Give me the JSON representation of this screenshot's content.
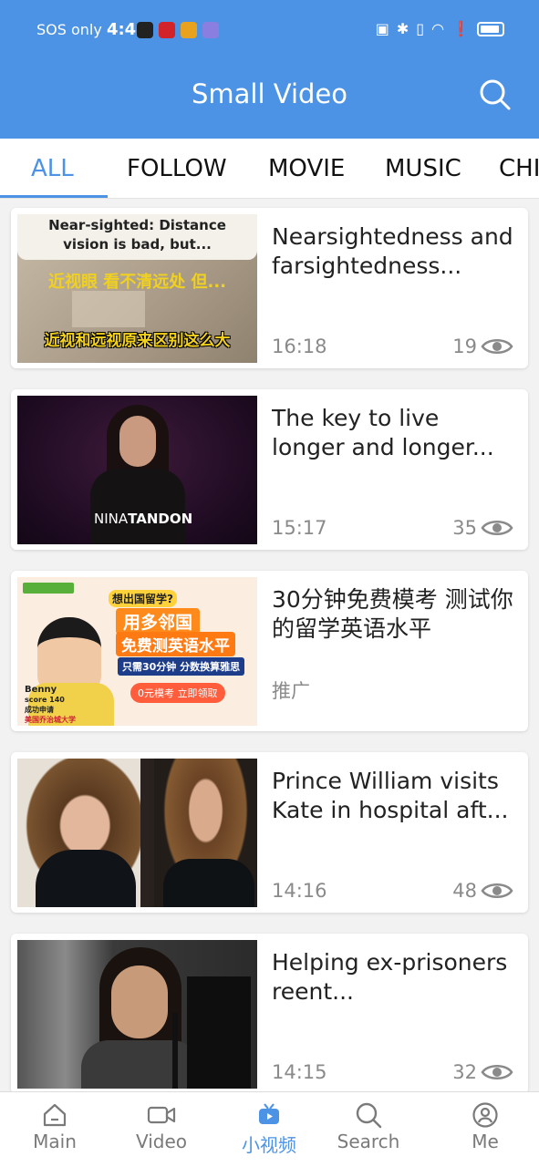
{
  "status": {
    "carrier": "SOS only",
    "time": "4:43"
  },
  "header": {
    "title": "Small Video"
  },
  "tabs": [
    {
      "label": "ALL",
      "active": true
    },
    {
      "label": "FOLLOW"
    },
    {
      "label": "MOVIE"
    },
    {
      "label": "MUSIC"
    },
    {
      "label": "CHI"
    }
  ],
  "videos": [
    {
      "title": "Nearsightedness and farsightedness...",
      "time": "16:18",
      "views": "19",
      "thumb_caption_en": "Near-sighted: Distance vision is bad, but...",
      "thumb_caption_zh1": "近视眼 看不清远处 但...",
      "thumb_caption_zh2": "近视和远视原来区别这么大"
    },
    {
      "title": "The key to live longer and longer...",
      "time": "15:17",
      "views": "35",
      "thumb_name_first": "NINA",
      "thumb_name_last": "TANDON"
    },
    {
      "title": "30分钟免费模考 测试你的留学英语水平",
      "ad_label": "推广",
      "ad_line1": "想出国留学?",
      "ad_line2": "用多邻国",
      "ad_line3": "免费测英语水平",
      "ad_line4": "只需30分钟 分数换算雅思",
      "ad_button": "0元模考 立即领取",
      "ad_person": "Benny",
      "ad_score": "score 140",
      "ad_success": "成功申请",
      "ad_school": "美国乔治城大学"
    },
    {
      "title": "Prince William visits Kate in hospital aft...",
      "time": "14:16",
      "views": "48"
    },
    {
      "title": "Helping ex-prisoners reent...",
      "time": "14:15",
      "views": "32"
    }
  ],
  "bottom_nav": [
    {
      "label": "Main",
      "icon": "home-icon"
    },
    {
      "label": "Video",
      "icon": "video-camera-icon"
    },
    {
      "label": "小视频",
      "icon": "tv-icon",
      "active": true
    },
    {
      "label": "Search",
      "icon": "search-icon"
    },
    {
      "label": "Me",
      "icon": "user-icon"
    }
  ],
  "colors": {
    "accent": "#4c93e6",
    "muted": "#8a8a8a"
  }
}
